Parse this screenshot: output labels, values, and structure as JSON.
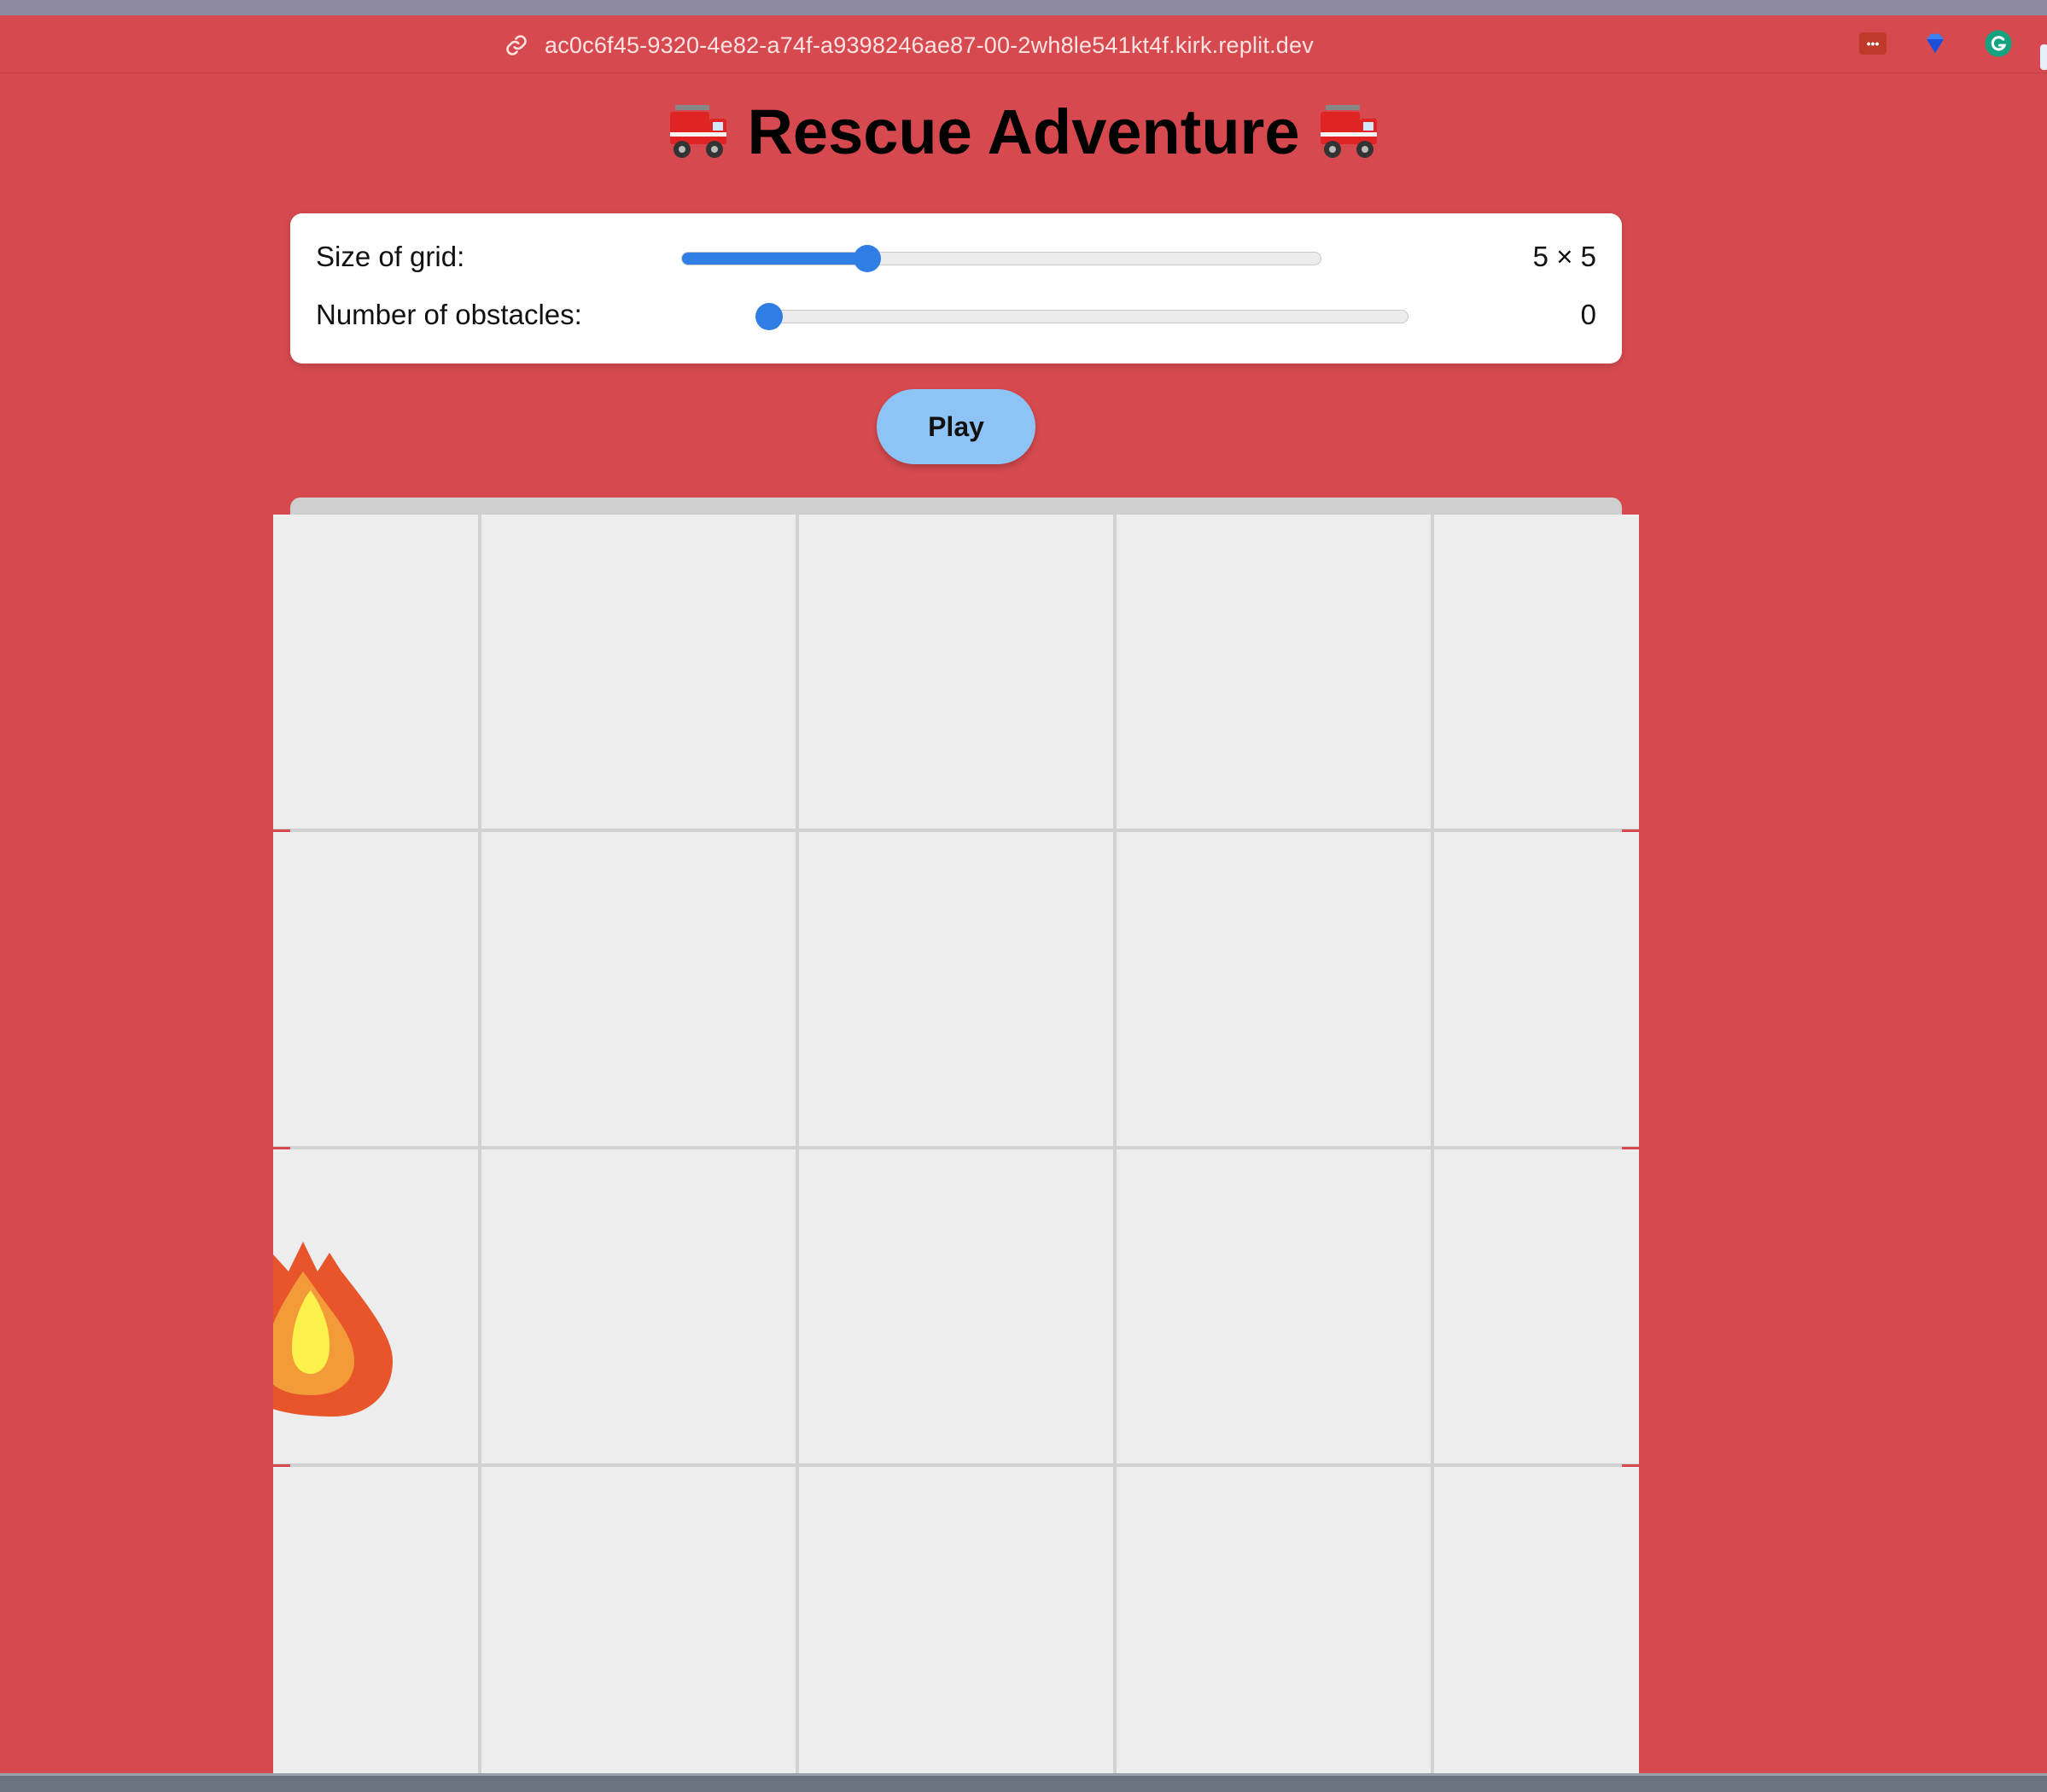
{
  "browser": {
    "url": "ac0c6f45-9320-4e82-a74f-a9398246ae87-00-2wh8le541kt4f.kirk.replit.dev",
    "extensions": [
      "more-dots-icon",
      "diamond-icon",
      "grammarly-icon"
    ]
  },
  "app": {
    "title": "Rescue Adventure",
    "title_icon": "fire-engine-icon"
  },
  "settings": {
    "grid_size": {
      "label": "Size of grid:",
      "value_text": "5 × 5",
      "slider_fraction": 0.29
    },
    "obstacles": {
      "label": "Number of obstacles:",
      "value_text": "0",
      "slider_fraction": 0.0
    }
  },
  "controls": {
    "play_label": "Play"
  },
  "board": {
    "rows_visible": 4,
    "columns": 5,
    "fire_cell": {
      "row": 3,
      "col": 1
    }
  },
  "colors": {
    "background": "#d64a4f",
    "slider_accent": "#2f7de5",
    "play_button": "#8ec3f5",
    "cell": "#ededed"
  }
}
